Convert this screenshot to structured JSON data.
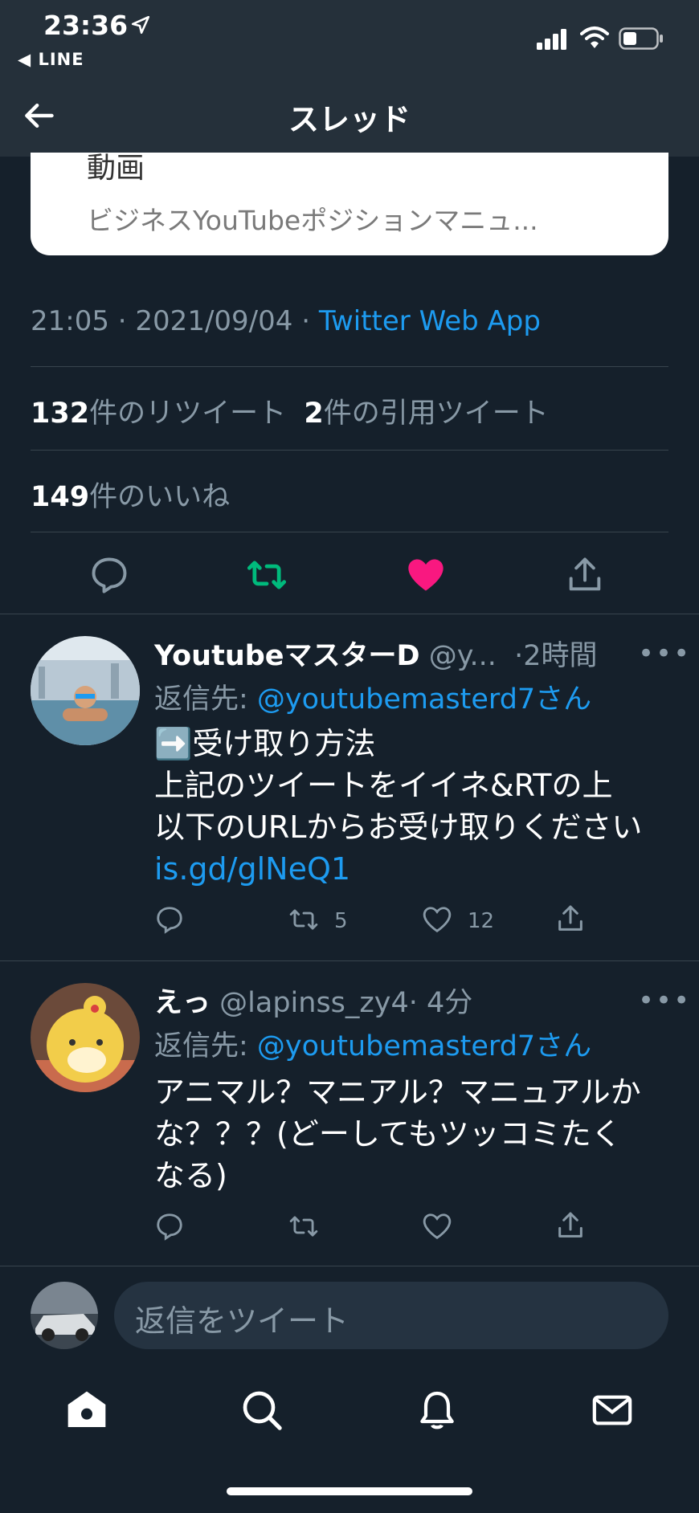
{
  "status_bar": {
    "time": "23:36",
    "back_app": "◀ LINE"
  },
  "header": {
    "title": "スレッド"
  },
  "card": {
    "title": "動画",
    "description": "ビジネスYouTubeポジションマニュ..."
  },
  "tweet_meta": {
    "time": "21:05",
    "date": "2021/09/04",
    "dot": " · ",
    "app": "Twitter Web App"
  },
  "stats": {
    "retweets_count": "132",
    "retweets_label": "件のリツイート",
    "quotes_count": "2",
    "quotes_label": "件の引用ツイート",
    "likes_count": "149",
    "likes_label": "件のいいね"
  },
  "actions": {
    "liked": true,
    "retweeted": true
  },
  "replies": [
    {
      "display_name": "YoutubeマスターD",
      "handle": "@y...",
      "time": "·2時間",
      "reply_prefix": "返信先: ",
      "reply_to": "@youtubemasterd7さん",
      "lines": [
        "➡️受け取り方法",
        "上記のツイートをイイネ&RTの上",
        "以下のURLからお受け取りください"
      ],
      "link": "is.gd/glNeQ1",
      "retweets": "5",
      "likes": "12"
    },
    {
      "display_name": "えっ",
      "handle": "@lapinss_zy4",
      "time": "· 4分",
      "reply_prefix": "返信先: ",
      "reply_to": "@youtubemasterd7さん",
      "lines": [
        "アニマル？マニアル？マニュアルか",
        "な？？？(どーしてもツッコミたく",
        "なる)"
      ]
    }
  ],
  "more_icon_text": "•••",
  "compose": {
    "placeholder": "返信をツイート"
  },
  "colors": {
    "background": "#15202b",
    "accent": "#1d9bf0",
    "like": "#f91880",
    "retweet": "#00ba7c"
  }
}
